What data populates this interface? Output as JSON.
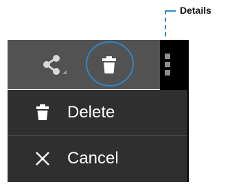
{
  "callout": {
    "label": "Details"
  },
  "toolbar": {
    "share_icon": "share-icon",
    "delete_icon": "trash-icon",
    "overflow_icon": "overflow-menu-icon"
  },
  "menu": {
    "items": [
      {
        "label": "Delete",
        "icon": "trash-icon"
      },
      {
        "label": "Cancel",
        "icon": "close-icon"
      }
    ]
  },
  "colors": {
    "toolbar_bg": "#525252",
    "menu_bg": "#2f2f2f",
    "highlight": "#2e86c9",
    "icon": "#ffffff"
  }
}
